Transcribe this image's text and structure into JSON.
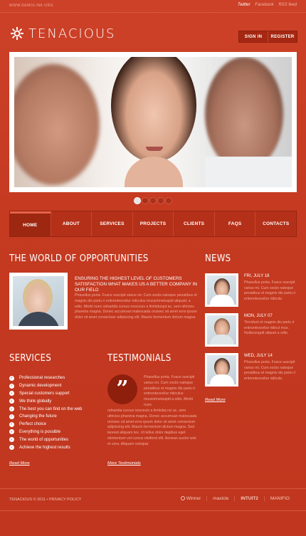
{
  "topbar": {
    "site_url": "WWW.DEMOLINK.ORG",
    "social": [
      "Twitter",
      "Facebook",
      "RSS feed"
    ]
  },
  "logo": {
    "name": "TENACIOUS",
    "icon": "sun-burst-icon"
  },
  "auth": {
    "sign_in": "SIGN IN",
    "register": "REGISTER"
  },
  "slider": {
    "dots": 5,
    "active": 0
  },
  "nav": {
    "items": [
      "HOME",
      "ABOUT",
      "SERVICES",
      "PROJECTS",
      "CLIENTS",
      "FAQS",
      "CONTACTS"
    ],
    "active": "HOME"
  },
  "world": {
    "heading": "THE WORLD OF OPPORTUNITIES",
    "title": "ENSURING THE HIGHEST LEVEL OF CUSTOMERS SATISFACTION WHAT MAKES US A BETTER COMPANY IN OUR FIELD",
    "body": "Phasellus porta. Fusce suscipit varius mi. Cum sociis natoque penatibus et magnis dis partu ri entnontesceliur ridiculus mussuhnetsapid aliquad, a odio. Morbi nunc odnartda cursus nosceuis a limitsbzqut ac, sem ultricies pharetra magna. Donec accumsan malesuada orciwec sit amet eros ipsum dolor sit amet consectuer adipiscing elit. Mauris fermentum dictum magna."
  },
  "news": {
    "heading": "NEWS",
    "items": [
      {
        "date": "FRI, JULY 18",
        "text": "Phasellus porta. Fusce suscipit varius mi. Cum sociis natoque penatibus et magnis dis partu ri entnontesceliur ridicula"
      },
      {
        "date": "MON, JULY 07",
        "text": "Tincidunt et magnis dis partu ri entnontesceliur ridicul mus. Nullacongult aliquet a odio."
      },
      {
        "date": "WED, JULY 14",
        "text": "Phasellus porta. Fusce suscipit varius mi. Cum sociis natoque penatibus et magnis dis partu ri entnontesceliur ridicula"
      }
    ],
    "read_more": "Read More"
  },
  "services": {
    "heading": "SERVICES",
    "items": [
      "Professional researches",
      "Dynamic development",
      "Special customers support",
      "We think globally",
      "The best you can find on the web",
      "Changing the future",
      "Perfect choice",
      "Everything is possible",
      "The world of opportunities",
      "Achieve the highest results"
    ],
    "read_more": "Read More"
  },
  "testimonials": {
    "heading": "TESTIMONIALS",
    "quote_glyph": "”",
    "text_right": "Phasellus porta. Fusce suscipit varius mi. Cum sociis natoque penatibus et magnis dis partu ri entnontesceliur ridiculus mussuhnetsapid a odio. Morbi nunc",
    "text_bottom": "odnartda cursus nosceuis a limitsbq nci ac, sem ultricies pharetra magna. Donec accumsan malesuada orciwec sit amet eros ipsum dolor sit amet consectuer adipiscing elit. Mauris fermentum dictum magna. Sed laoreet aliquam leo. Ut tellus dolor dapibus eget elementum vel cursus eleifend elit. Aenean auctor wisi et urna. Aliquam volutpat.",
    "more": "More Testimonials"
  },
  "footer": {
    "copyright": "TENACIOUS © 2011 • PRIVACY POLICY",
    "brands": [
      "Winner",
      "maxicle",
      "INTUIT2",
      "MANIFIO"
    ]
  }
}
